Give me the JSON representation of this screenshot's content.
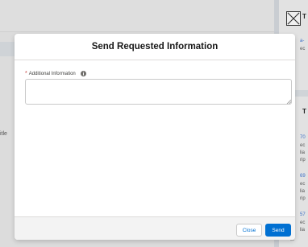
{
  "background": {
    "side_text": "itle",
    "right_panel": {
      "title_fragment": "T",
      "heading_fragment": "T",
      "lines": [
        {
          "text": "a-",
          "kind": "link"
        },
        {
          "text": "ec",
          "kind": "text"
        },
        {
          "text": "70",
          "kind": "link"
        },
        {
          "text": "ec",
          "kind": "text"
        },
        {
          "text": "lia",
          "kind": "text"
        },
        {
          "text": "rip",
          "kind": "text"
        },
        {
          "text": "69",
          "kind": "link"
        },
        {
          "text": "ec",
          "kind": "text"
        },
        {
          "text": "lia",
          "kind": "text"
        },
        {
          "text": "rip",
          "kind": "text"
        },
        {
          "text": "57",
          "kind": "link"
        },
        {
          "text": "ec",
          "kind": "text"
        },
        {
          "text": "lia",
          "kind": "text"
        }
      ]
    }
  },
  "modal": {
    "title": "Send Requested Information",
    "field": {
      "required_marker": "*",
      "label": "Additional Information",
      "value": ""
    },
    "footer": {
      "close_label": "Close",
      "send_label": "Send"
    }
  },
  "colors": {
    "brand": "#0070d2",
    "required": "#c23934",
    "overlay": "#dcdcdc"
  },
  "icons": {
    "info": "info-icon",
    "close_window": "close-window-icon",
    "resize": "resize-handle-icon"
  }
}
